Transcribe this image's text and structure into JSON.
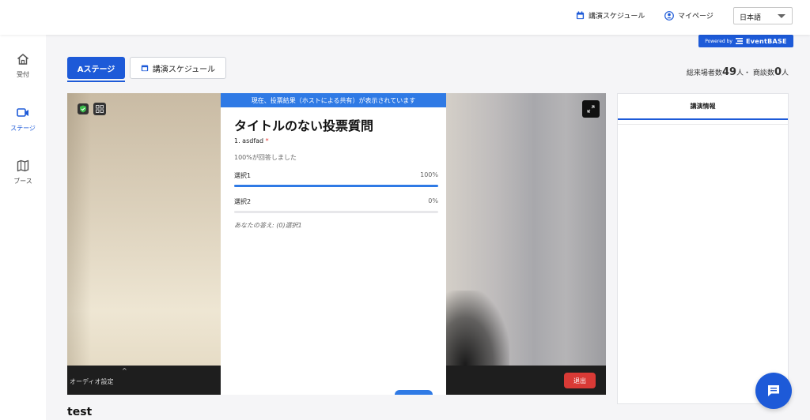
{
  "header": {
    "schedule_link": "講演スケジュール",
    "mypage_link": "マイページ",
    "language": "日本語",
    "powered_prefix": "Powered by",
    "brand": "EventBASE"
  },
  "sidebar": {
    "items": [
      {
        "label": "受付",
        "icon": "home-icon"
      },
      {
        "label": "ステージ",
        "icon": "camera-icon",
        "active": true
      },
      {
        "label": "ブース",
        "icon": "map-icon"
      }
    ]
  },
  "tabs": {
    "stage_a": "Aステージ",
    "schedule": "講演スケジュール"
  },
  "stats": {
    "visitors_label": "総来場者数",
    "visitors_value": "49",
    "visitors_unit": "人・",
    "meetings_label": "商談数",
    "meetings_value": "0",
    "meetings_unit": "人"
  },
  "stage": {
    "audio_settings": "オーディオ設定",
    "leave_button": "退出"
  },
  "poll": {
    "banner": "現在、投票結果（ホストによる共有）が表示されています",
    "title": "タイトルのない投票質問",
    "question": "1. asdfad",
    "required_mark": "*",
    "response_rate": "100%が回答しました",
    "options": [
      {
        "label": "選択1",
        "percent_text": "100%",
        "percent": 100
      },
      {
        "label": "選択2",
        "percent_text": "0%",
        "percent": 0
      }
    ],
    "your_answer": "あなたの答え: (0)選択1"
  },
  "info_panel": {
    "tab": "講演情報"
  },
  "page_title": "test",
  "colors": {
    "primary": "#1d5ad8",
    "poll_blue": "#2f7ae5",
    "leave_red": "#d93a36"
  }
}
